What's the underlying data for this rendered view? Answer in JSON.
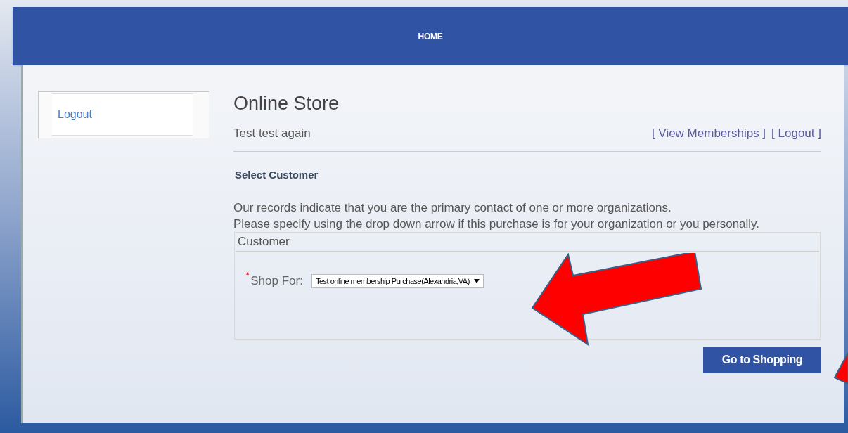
{
  "header": {
    "title": "HOME"
  },
  "sidebar": {
    "items": [
      {
        "label": "Logout"
      }
    ]
  },
  "page": {
    "title": "Online Store",
    "user": "Test test again",
    "links": [
      {
        "label": "[ View Memberships ]"
      },
      {
        "label": "[ Logout ]"
      }
    ],
    "section_title": "Select Customer",
    "intro": [
      "Our records indicate that you are the primary contact of one or more organizations.",
      "Please specify using the drop down arrow if this purchase is for your organization or you personally."
    ],
    "fieldset": {
      "legend": "Customer",
      "field": {
        "label": "Shop For:",
        "required": true,
        "required_mark": "*",
        "value": "Test online membership Purchase(Alexandria,VA)"
      }
    },
    "button": "Go to Shopping"
  }
}
